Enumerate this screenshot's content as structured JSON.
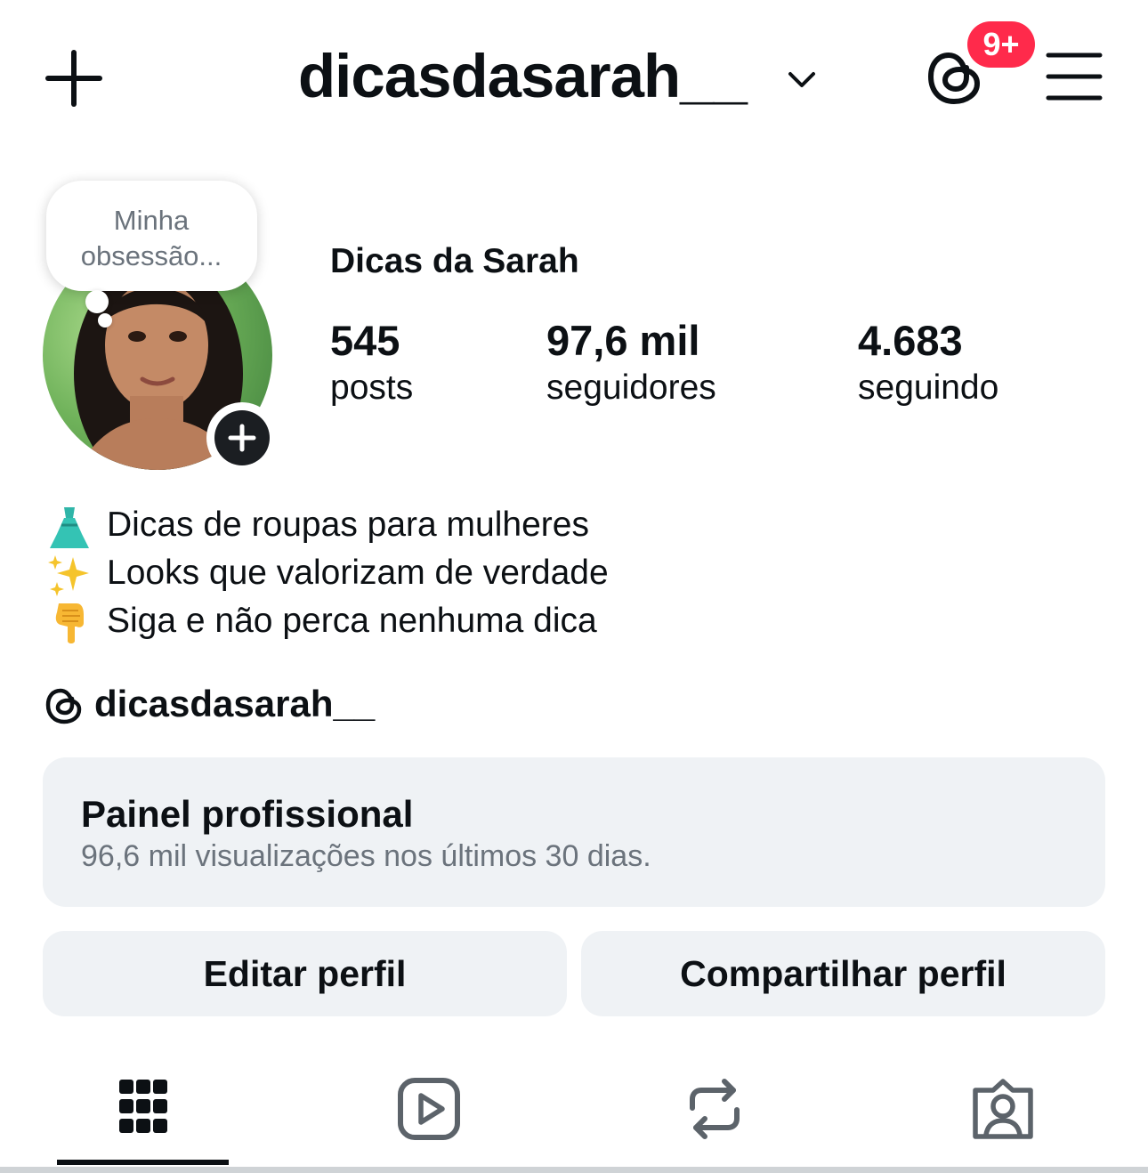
{
  "header": {
    "username": "dicasdasarah__",
    "notification_badge": "9+",
    "badge_color": "#ff2a4b"
  },
  "profile": {
    "note": "Minha obsessão...",
    "display_name": "Dicas da Sarah",
    "stats": [
      {
        "value": "545",
        "label": "posts"
      },
      {
        "value": "97,6 mil",
        "label": "seguidores"
      },
      {
        "value": "4.683",
        "label": "seguindo"
      }
    ],
    "bio": [
      {
        "icon": "dress-emoji",
        "text": "Dicas de roupas para mulheres"
      },
      {
        "icon": "sparkles-emoji",
        "text": "Looks que valorizam de verdade"
      },
      {
        "icon": "pointing-down-emoji",
        "text": "Siga e não perca nenhuma dica"
      }
    ],
    "threads_handle": "dicasdasarah__"
  },
  "professional_panel": {
    "title": "Painel profissional",
    "subtitle": "96,6 mil visualizações nos últimos 30 dias."
  },
  "actions": {
    "edit": "Editar perfil",
    "share": "Compartilhar perfil"
  },
  "tabs": [
    "grid-icon",
    "reels-icon",
    "reposts-icon",
    "tagged-icon"
  ],
  "colors": {
    "text": "#0c1014",
    "secondary_text": "#6b737c",
    "panel_bg": "#eff2f5",
    "accent": "#ff2a4b"
  }
}
